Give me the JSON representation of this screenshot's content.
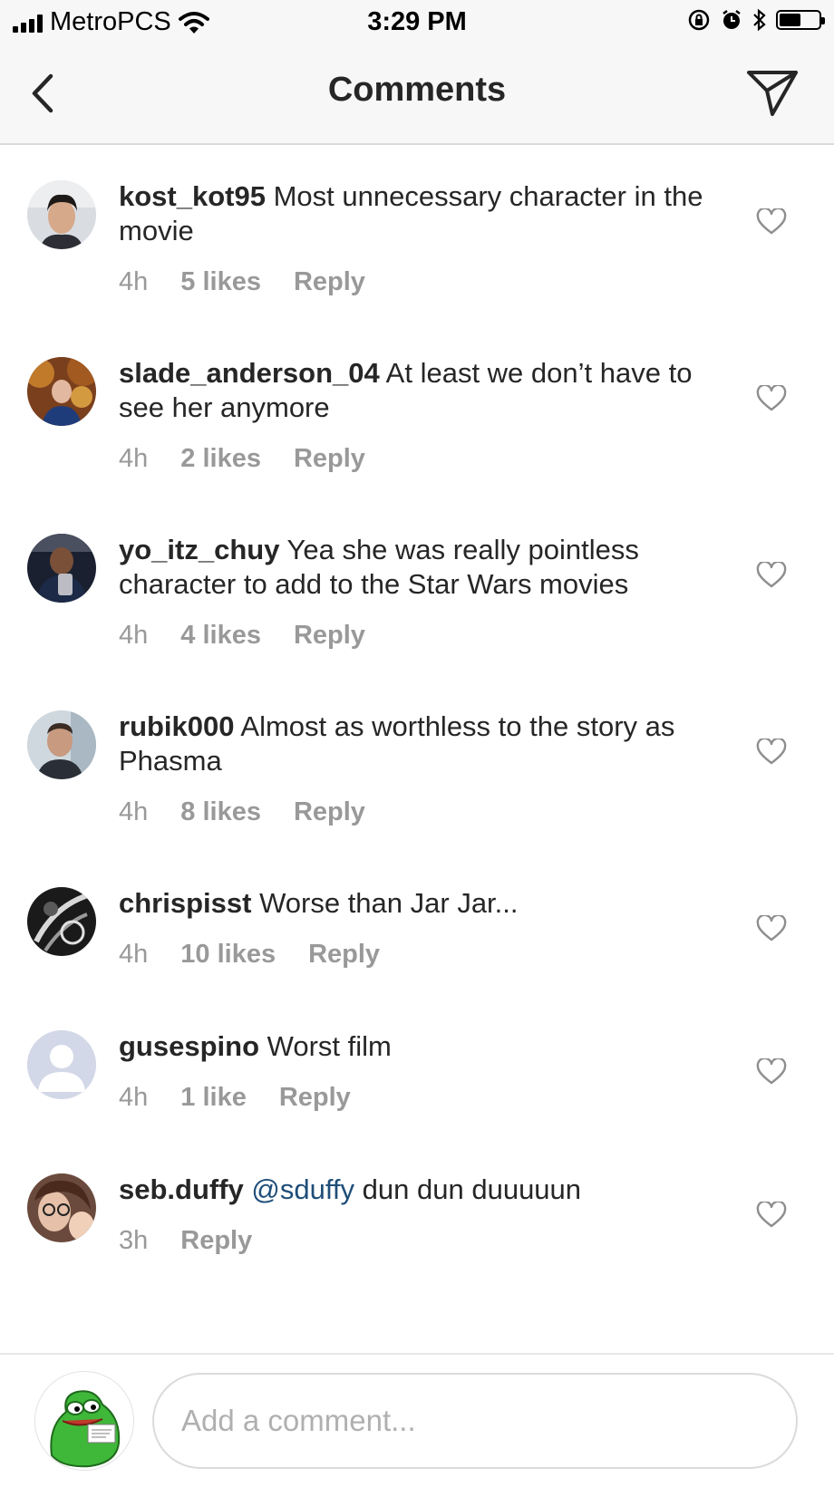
{
  "status_bar": {
    "carrier": "MetroPCS",
    "time": "3:29 PM",
    "battery_level": 0.55
  },
  "header": {
    "title": "Comments"
  },
  "comments": [
    {
      "username": "kost_kot95",
      "mention": "",
      "text": "Most unnecessary character in the movie",
      "time": "4h",
      "likes": "5 likes",
      "reply": "Reply"
    },
    {
      "username": "slade_anderson_04",
      "mention": "",
      "text": "At least we don’t have to see her anymore",
      "time": "4h",
      "likes": "2 likes",
      "reply": "Reply"
    },
    {
      "username": "yo_itz_chuy",
      "mention": "",
      "text": "Yea she was really pointless character to add to the Star Wars movies",
      "time": "4h",
      "likes": "4 likes",
      "reply": "Reply"
    },
    {
      "username": "rubik000",
      "mention": "",
      "text": "Almost as worthless to the story as Phasma",
      "time": "4h",
      "likes": "8 likes",
      "reply": "Reply"
    },
    {
      "username": "chrispisst",
      "mention": "",
      "text": "Worse than Jar Jar...",
      "time": "4h",
      "likes": "10 likes",
      "reply": "Reply"
    },
    {
      "username": "gusespino",
      "mention": "",
      "text": "Worst film",
      "time": "4h",
      "likes": "1 like",
      "reply": "Reply"
    },
    {
      "username": "seb.duffy",
      "mention": "@sduffy",
      "text": "dun dun duuuuun",
      "time": "3h",
      "likes": "",
      "reply": "Reply"
    }
  ],
  "composer": {
    "placeholder": "Add a comment..."
  },
  "colors": {
    "bar_bg": "#f7f7f7",
    "text": "#262626",
    "meta": "#999999",
    "mention": "#1f4e79"
  }
}
